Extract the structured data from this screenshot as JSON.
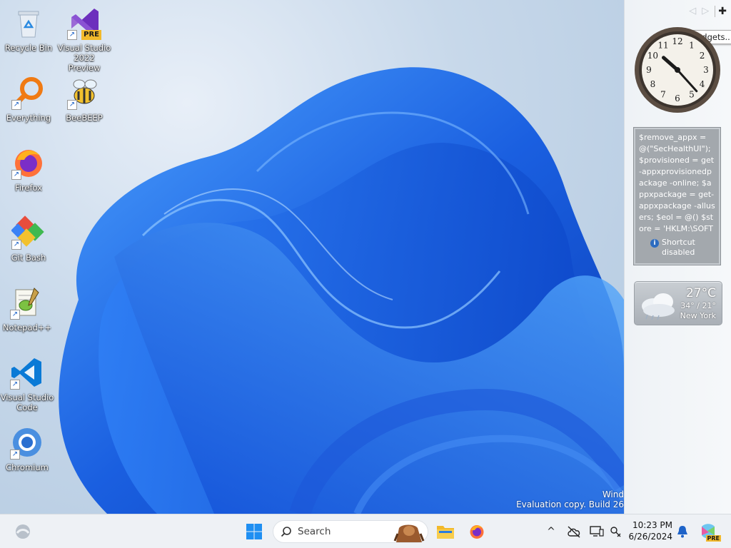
{
  "desktop": {
    "icons": [
      {
        "label": "Recycle Bin"
      },
      {
        "label": "Visual Studio 2022 Preview",
        "badge": "PRE"
      },
      {
        "label": "Everything"
      },
      {
        "label": "BeeBEEP"
      },
      {
        "label": "Firefox"
      },
      {
        "label": "Git Bash"
      },
      {
        "label": "Notepad++"
      },
      {
        "label": "Visual Studio Code"
      },
      {
        "label": "Chromium"
      }
    ],
    "watermark": {
      "line1": "Wind",
      "line2": "Evaluation copy. Build 26"
    }
  },
  "sidebar": {
    "add_gadgets_tooltip": "Add gadgets...",
    "clock": {
      "numbers": [
        "12",
        "1",
        "2",
        "3",
        "4",
        "5",
        "6",
        "7",
        "8",
        "9",
        "10",
        "11"
      ],
      "time": "10:23"
    },
    "note": {
      "text": "$remove_appx = @(\"SecHealthUI\"); $provisioned = get-appxprovisionedpackage -online; $appxpackage = get-appxpackage -allusers; $eol = @() $store = 'HKLM:\\SOFTWARE\\",
      "shortcut_status": "Shortcut disabled"
    },
    "weather": {
      "temp": "27°C",
      "range": "34° / 21°",
      "city": "New York"
    }
  },
  "taskbar": {
    "search_placeholder": "Search",
    "time": "10:23 PM",
    "date": "6/26/2024",
    "copilot_badge": "PRE"
  },
  "colors": {
    "accent": "#0067c0",
    "wallpaper_blue": "#1a5fe0"
  }
}
